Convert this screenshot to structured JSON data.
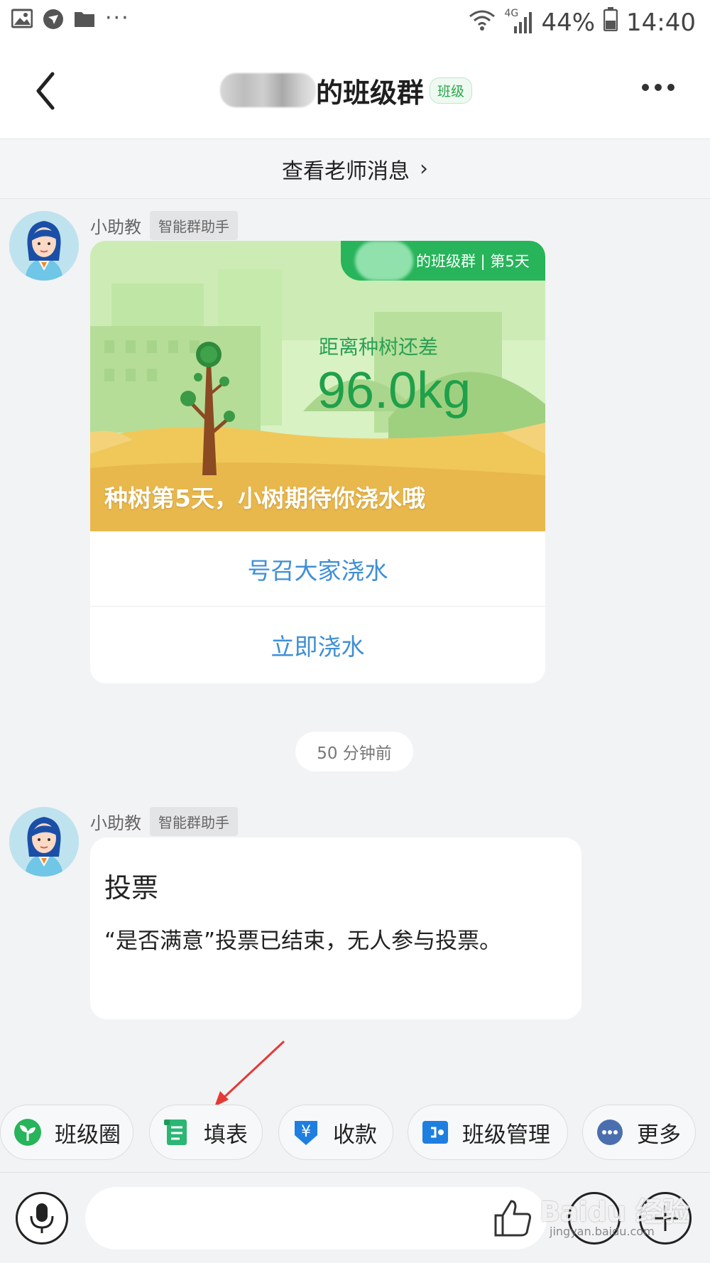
{
  "status_bar": {
    "signal": "4G",
    "battery": "44%",
    "time": "14:40",
    "overflow": "···"
  },
  "header": {
    "title": "的班级群",
    "badge": "班级"
  },
  "teacher_bar": {
    "label": "查看老师消息",
    "chevron": "›"
  },
  "messages": [
    {
      "sender": "小助教",
      "tag": "智能群助手",
      "card": {
        "pill": "的班级群 | 第5天",
        "distance_label": "距离种树还差",
        "distance_value": "96.0kg",
        "caption": "种树第5天，小树期待你浇水哦",
        "buttons": [
          "号召大家浇水",
          "立即浇水"
        ]
      }
    },
    {
      "sender": "小助教",
      "tag": "智能群助手",
      "vote": {
        "title": "投票",
        "body": "“是否满意”投票已结束，无人参与投票。"
      }
    }
  ],
  "time_separator": "50 分钟前",
  "quick_actions": [
    {
      "label": "班级圈",
      "icon": "sprout-icon"
    },
    {
      "label": "填表",
      "icon": "form-icon"
    },
    {
      "label": "收款",
      "icon": "yuan-payment-icon"
    },
    {
      "label": "班级管理",
      "icon": "class-manage-icon"
    },
    {
      "label": "更多",
      "icon": "more-dots-icon"
    }
  ],
  "input": {
    "placeholder": ""
  },
  "watermark": {
    "main": "Baidu 经验",
    "sub": "jingyan.baidu.com"
  },
  "colors": {
    "accent_green": "#27b45a",
    "link_blue": "#3f8fd6",
    "annotation_red": "#e53935"
  }
}
